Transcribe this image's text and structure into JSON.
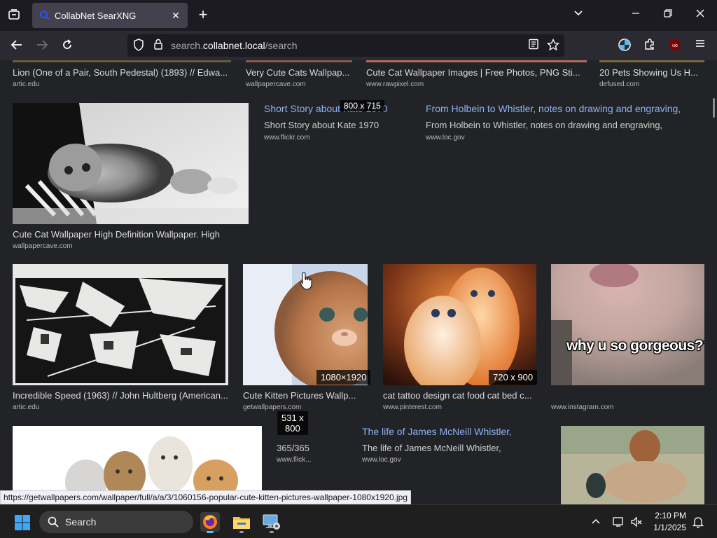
{
  "browser": {
    "tab_title": "CollabNet SearXNG",
    "url_prefix": "search.",
    "url_domain": "collabnet.local",
    "url_path": "/search",
    "status_url": "https://getwallpapers.com/wallpaper/full/a/a/3/1060156-popular-cute-kitten-pictures-wallpaper-1080x1920.jpg"
  },
  "top_row": [
    {
      "title": "Lion (One of a Pair, South Pedestal) (1893) // Edwa...",
      "source": "artic.edu"
    },
    {
      "title": "Very Cute Cats Wallpap...",
      "source": "wallpapercave.com"
    },
    {
      "title": "Cute Cat Wallpaper Images | Free Photos, PNG Sti...",
      "source": "www.rawpixel.com"
    },
    {
      "title": "20 Pets Showing Us H...",
      "source": "defused.com"
    }
  ],
  "row2": {
    "main_caption": "Cute Cat Wallpaper High Definition Wallpaper. High",
    "main_source": "wallpapercave.com",
    "mid_link": "Short Story about Kate 1970",
    "mid_snippet": "Short Story about Kate 1970",
    "mid_source": "www.flickr.com",
    "mid_dim": "800 x 715",
    "right_link": "From Holbein to Whistler, notes on drawing and engraving,",
    "right_snippet": "From Holbein to Whistler, notes on drawing and engraving,",
    "right_source": "www.loc.gov"
  },
  "row3": [
    {
      "title": "Incredible Speed (1963) // John Hultberg (American...",
      "source": "artic.edu",
      "dim": ""
    },
    {
      "title": "Cute Kitten Pictures Wallp...",
      "source": "getwallpapers.com",
      "dim": "1080×1920"
    },
    {
      "title": "cat tattoo design cat food cat bed c...",
      "source": "www.pinterest.com",
      "dim": "720 x 900"
    },
    {
      "title": "",
      "source": "www.instagram.com",
      "dim": "",
      "overlay": "why u so gorgeous??"
    }
  ],
  "row4": {
    "mid_dim_line1": "531 x",
    "mid_dim_line2": "800",
    "mid_snippet": "365/365",
    "mid_source": "www.flick...",
    "right_link": "The life of James McNeill Whistler,",
    "right_snippet": "The life of James McNeill Whistler,",
    "right_source": "www.loc.gov"
  },
  "taskbar": {
    "search_label": "Search",
    "time": "2:10 PM",
    "date": "1/1/2025"
  },
  "colors": {
    "link": "#8bb2f2",
    "page_bg": "#222327",
    "toolbar_bg": "#2b2a33"
  }
}
